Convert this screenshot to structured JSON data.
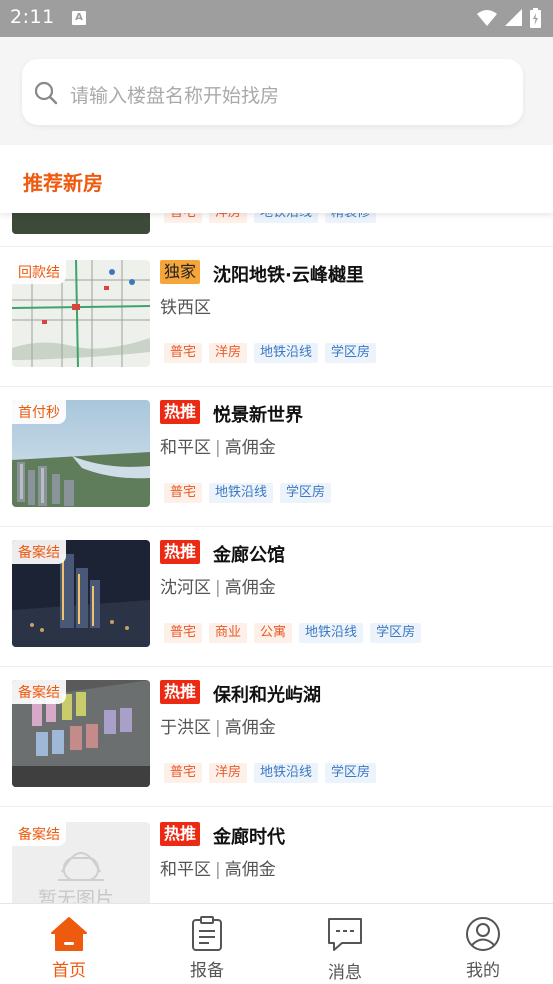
{
  "status_bar": {
    "time": "2:11"
  },
  "search": {
    "placeholder": "请输入楼盘名称开始找房"
  },
  "section": {
    "title": "推荐新房"
  },
  "partial_top_item": {
    "tags": [
      "普宅",
      "洋房",
      "地铁沿线",
      "精装修"
    ]
  },
  "listings": [
    {
      "corner_label": "回款结",
      "badge": "独家",
      "badge_type": "exclusive",
      "name": "沈阳地铁·云峰樾里",
      "district": "铁西区",
      "commission": "",
      "tags": [
        {
          "text": "普宅",
          "type": "orange"
        },
        {
          "text": "洋房",
          "type": "orange"
        },
        {
          "text": "地铁沿线",
          "type": "blue"
        },
        {
          "text": "学区房",
          "type": "blue"
        }
      ],
      "image": "map"
    },
    {
      "corner_label": "首付秒",
      "badge": "热推",
      "badge_type": "hot",
      "name": "悦景新世界",
      "district": "和平区",
      "commission": "高佣金",
      "tags": [
        {
          "text": "普宅",
          "type": "orange"
        },
        {
          "text": "地铁沿线",
          "type": "blue"
        },
        {
          "text": "学区房",
          "type": "blue"
        }
      ],
      "image": "city"
    },
    {
      "corner_label": "备案结",
      "badge": "热推",
      "badge_type": "hot",
      "name": "金廊公馆",
      "district": "沈河区",
      "commission": "高佣金",
      "tags": [
        {
          "text": "普宅",
          "type": "orange"
        },
        {
          "text": "商业",
          "type": "orange"
        },
        {
          "text": "公寓",
          "type": "orange"
        },
        {
          "text": "地铁沿线",
          "type": "blue"
        },
        {
          "text": "学区房",
          "type": "blue"
        }
      ],
      "image": "night"
    },
    {
      "corner_label": "备案结",
      "badge": "热推",
      "badge_type": "hot",
      "name": "保利和光屿湖",
      "district": "于洪区",
      "commission": "高佣金",
      "tags": [
        {
          "text": "普宅",
          "type": "orange"
        },
        {
          "text": "洋房",
          "type": "orange"
        },
        {
          "text": "地铁沿线",
          "type": "blue"
        },
        {
          "text": "学区房",
          "type": "blue"
        }
      ],
      "image": "aerial"
    },
    {
      "corner_label": "备案结",
      "badge": "热推",
      "badge_type": "hot",
      "name": "金廊时代",
      "district": "和平区",
      "commission": "高佣金",
      "tags": [],
      "image": "placeholder",
      "placeholder_text": "暂无图片"
    }
  ],
  "bottom_nav": [
    {
      "label": "首页",
      "icon": "home-icon",
      "active": true
    },
    {
      "label": "报备",
      "icon": "clipboard-icon",
      "active": false
    },
    {
      "label": "消息",
      "icon": "message-icon",
      "active": false
    },
    {
      "label": "我的",
      "icon": "user-icon",
      "active": false
    }
  ],
  "colors": {
    "accent": "#ee5a0e",
    "hot_badge": "#ec2a13",
    "exclusive_badge": "#f5a53a"
  }
}
